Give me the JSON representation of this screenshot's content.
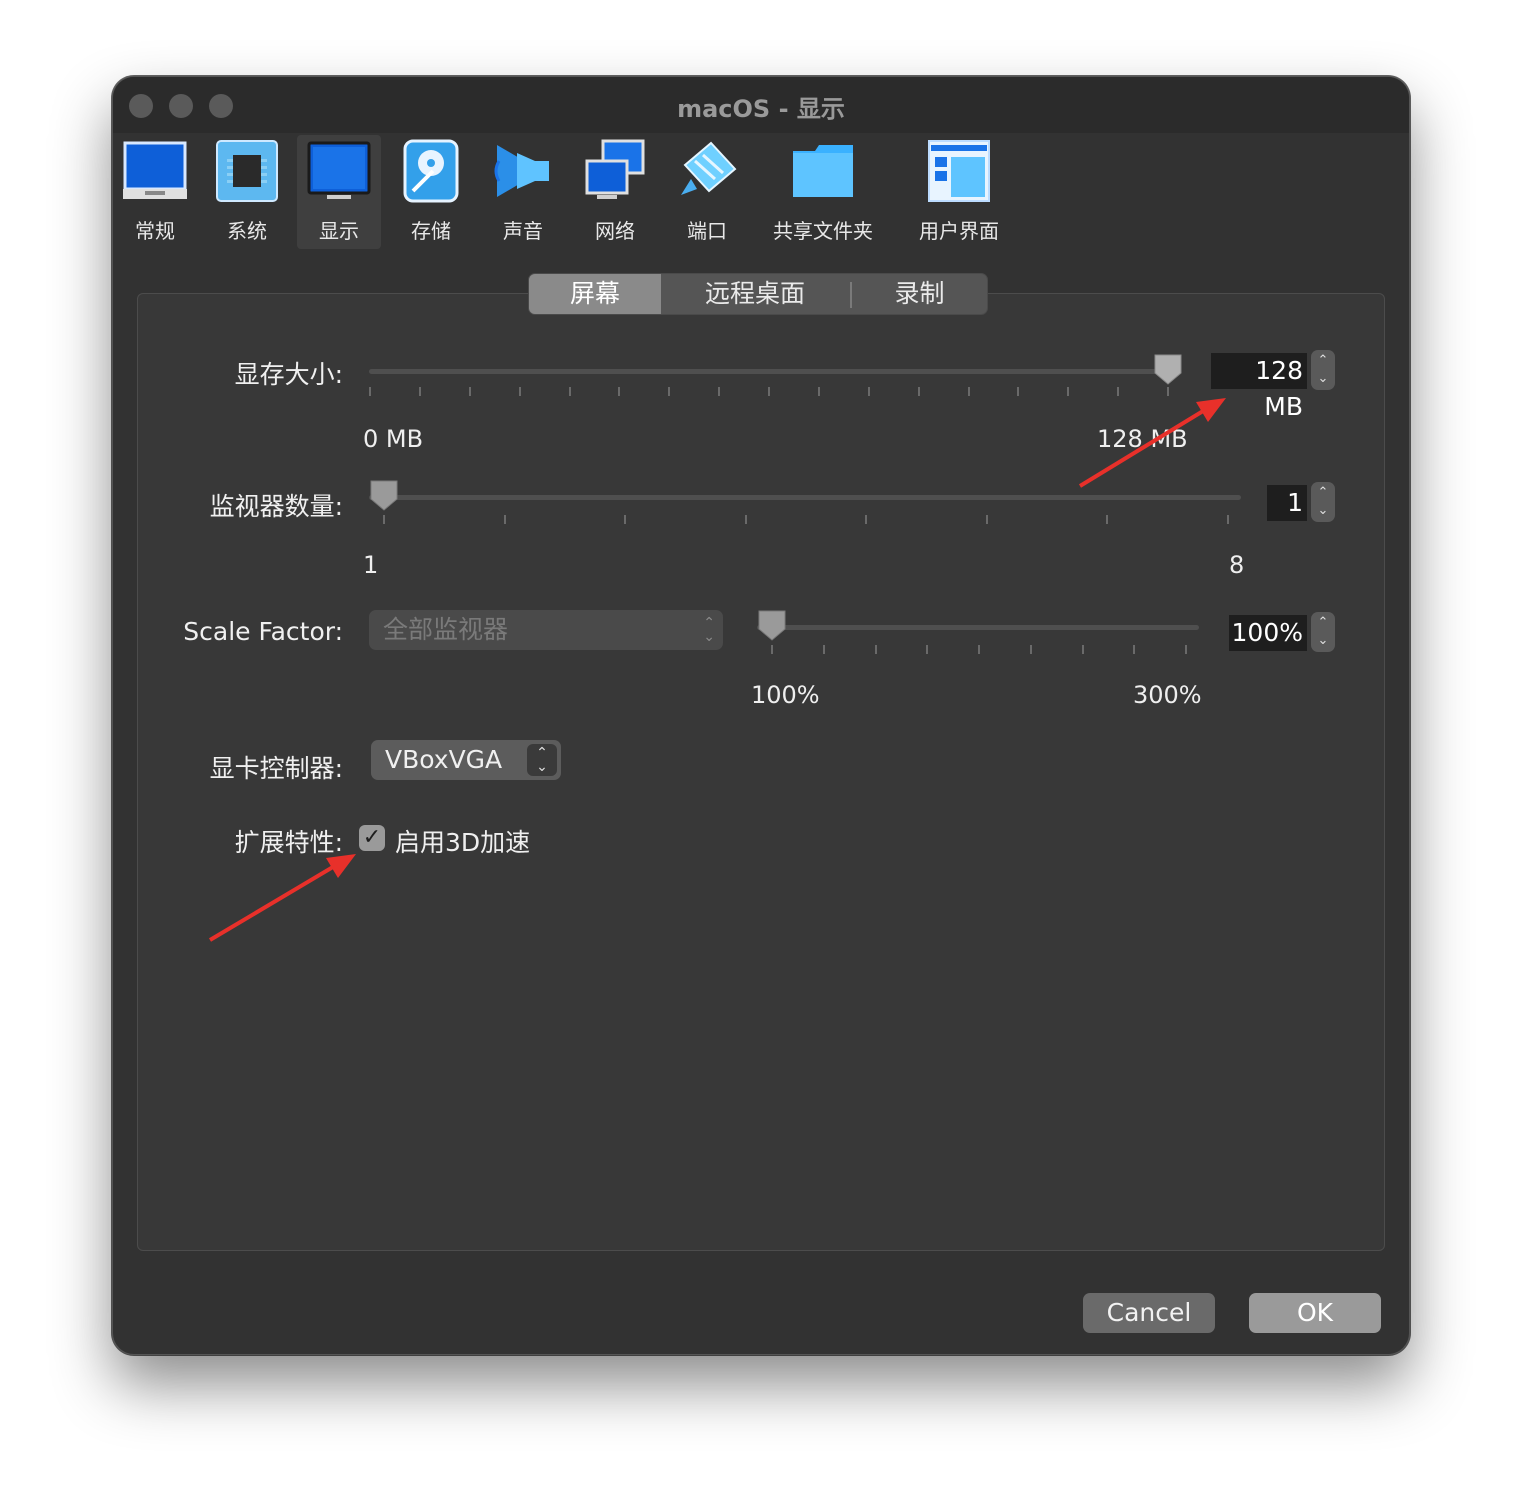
{
  "window": {
    "title": "macOS - 显示"
  },
  "toolbar": {
    "items": [
      {
        "label": "常规",
        "icon": "general-icon"
      },
      {
        "label": "系统",
        "icon": "chip-icon"
      },
      {
        "label": "显示",
        "icon": "monitor-icon",
        "active": true
      },
      {
        "label": "存储",
        "icon": "disk-icon"
      },
      {
        "label": "声音",
        "icon": "speaker-icon"
      },
      {
        "label": "网络",
        "icon": "network-icon"
      },
      {
        "label": "端口",
        "icon": "port-icon"
      },
      {
        "label": "共享文件夹",
        "icon": "folder-icon"
      },
      {
        "label": "用户界面",
        "icon": "window-layout-icon"
      }
    ]
  },
  "tabs": [
    {
      "label": "屏幕",
      "selected": true
    },
    {
      "label": "远程桌面",
      "selected": false
    },
    {
      "label": "录制",
      "selected": false
    }
  ],
  "video_memory": {
    "label": "显存大小:",
    "value": "128 MB",
    "min_label": "0 MB",
    "max_label": "128 MB",
    "level": 1.0
  },
  "monitor_count": {
    "label": "监视器数量:",
    "value": "1",
    "min_label": "1",
    "max_label": "8",
    "level": 0.0
  },
  "scale_factor": {
    "label": "Scale Factor:",
    "monitor_select": "全部监视器",
    "value": "100%",
    "min_label": "100%",
    "max_label": "300%",
    "level": 0.0
  },
  "graphics_controller": {
    "label": "显卡控制器:",
    "value": "VBoxVGA"
  },
  "extended_features": {
    "label": "扩展特性:",
    "checkbox_label": "启用3D加速",
    "checked": true
  },
  "buttons": {
    "cancel": "Cancel",
    "ok": "OK"
  },
  "colors": {
    "annotation_arrow": "#e8302a",
    "window_bg": "#323232",
    "panel_bg": "#383838",
    "icon_blue": "#1f7fe0"
  }
}
